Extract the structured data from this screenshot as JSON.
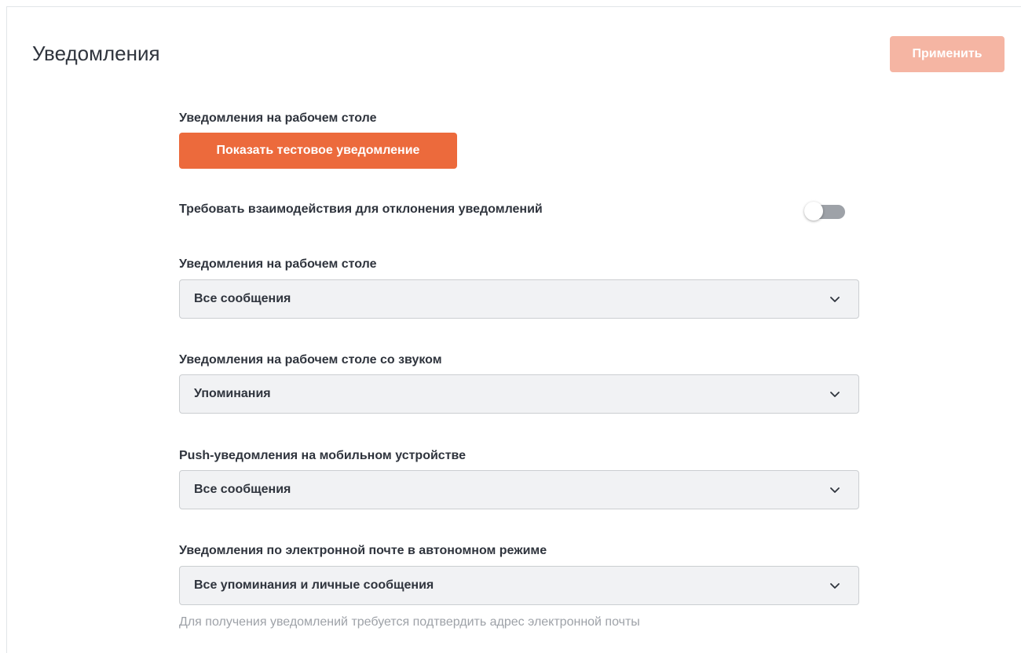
{
  "header": {
    "title": "Уведомления",
    "apply_label": "Применить"
  },
  "colors": {
    "accent": "#ec6a3c",
    "accent_disabled": "#f5b5a3",
    "toggle_off": "#9ea2a8",
    "select_bg": "#f1f2f4",
    "hint_text": "#9ea2a8"
  },
  "desktop_section": {
    "label": "Уведомления на рабочем столе",
    "test_button_label": "Показать тестовое уведомление"
  },
  "require_interaction": {
    "label": "Требовать взаимодействия для отклонения уведомлений",
    "enabled": false
  },
  "selects": [
    {
      "label": "Уведомления на рабочем столе",
      "value": "Все сообщения"
    },
    {
      "label": "Уведомления на рабочем столе со звуком",
      "value": "Упоминания"
    },
    {
      "label": "Push-уведомления на мобильном устройстве",
      "value": "Все сообщения"
    },
    {
      "label": "Уведомления по электронной почте в автономном режиме",
      "value": "Все упоминания и личные сообщения"
    }
  ],
  "email_hint": "Для получения уведомлений требуется подтвердить адрес электронной почты",
  "icons": {
    "dropdown": "chevron-down-icon"
  }
}
